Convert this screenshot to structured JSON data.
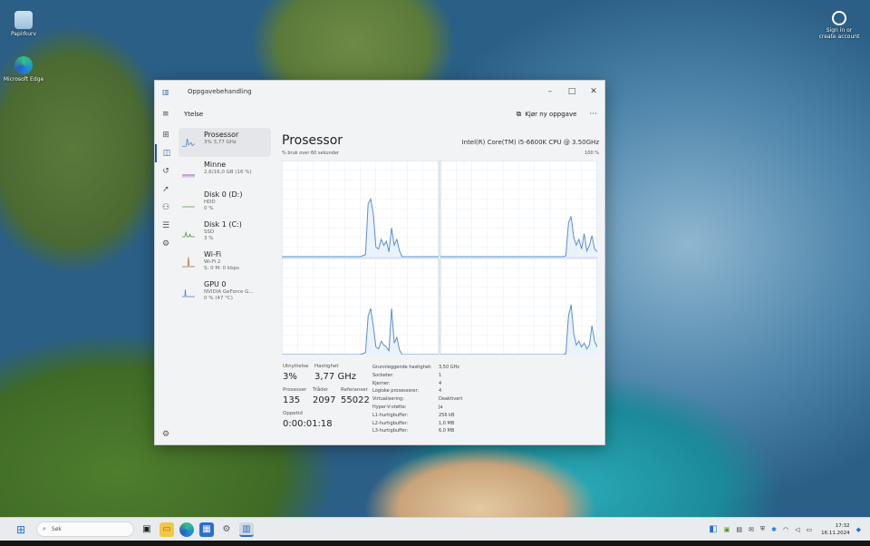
{
  "desktop": {
    "icons": [
      {
        "label": "Papirkurv",
        "icon": "recycle-bin-icon"
      },
      {
        "label": "Microsoft Edge",
        "icon": "edge-icon"
      },
      {
        "label": "Sign in or create account",
        "icon": "account-icon"
      }
    ]
  },
  "window": {
    "app_title": "Oppgavebehandling",
    "controls": {
      "minimize": "–",
      "maximize": "□",
      "close": "✕"
    },
    "page_title": "Ytelse",
    "run_task": "Kjør ny oppgave",
    "more": "···"
  },
  "resources": [
    {
      "name": "Prosessor",
      "detail": "3% 3,77 GHz",
      "color": "#3d7bc4"
    },
    {
      "name": "Minne",
      "detail": "2,6/16,0 GB (16 %)",
      "color": "#8e4ab0"
    },
    {
      "name": "Disk 0 (D:)",
      "detail": "HDD",
      "detail2": "0 %",
      "color": "#4f8f3a"
    },
    {
      "name": "Disk 1 (C:)",
      "detail": "SSD",
      "detail2": "3 %",
      "color": "#4f8f3a"
    },
    {
      "name": "Wi-Fi",
      "detail": "Wi-Fi 2",
      "detail2": "S: 0 M: 0 kbps",
      "color": "#b0622a"
    },
    {
      "name": "GPU 0",
      "detail": "NVIDIA GeForce G...",
      "detail2": "0 % (47 °C)",
      "color": "#3d7bc4"
    }
  ],
  "main": {
    "title": "Prosessor",
    "cpu_name": "Intel(R) Core(TM) i5-6600K CPU @ 3.50GHz",
    "graph_caption": "% bruk over 60 sekunder",
    "graph_max": "100 %",
    "line_color": "#5b8fd0",
    "stats": {
      "utilization_label": "Utnyttelse",
      "utilization": "3%",
      "speed_label": "Hastighet",
      "speed": "3,77 GHz",
      "processes_label": "Prosesser",
      "processes": "135",
      "threads_label": "Tråder",
      "threads": "2097",
      "handles_label": "Referanser",
      "handles": "55022",
      "uptime_label": "Oppetid",
      "uptime": "0:00:01:18"
    },
    "specs": [
      {
        "k": "Grunnleggende hastighet:",
        "v": "3,50 GHz"
      },
      {
        "k": "Socketer:",
        "v": "1"
      },
      {
        "k": "Kjerner:",
        "v": "4"
      },
      {
        "k": "Logiske prosessorer:",
        "v": "4"
      },
      {
        "k": "Virtualisering:",
        "v": "Deaktivert"
      },
      {
        "k": "Hyper-V-støtte:",
        "v": "Ja"
      },
      {
        "k": "L1-hurtigbuffer:",
        "v": "256 kB"
      },
      {
        "k": "L2-hurtigbuffer:",
        "v": "1,0 MB"
      },
      {
        "k": "L3-hurtigbuffer:",
        "v": "6,0 MB"
      }
    ],
    "core_usage": [
      [
        0,
        0,
        0,
        0,
        0,
        0,
        0,
        0,
        0,
        0,
        0,
        0,
        0,
        0,
        0,
        0,
        0,
        0,
        0,
        0,
        0,
        0,
        0,
        0,
        0,
        0,
        0,
        0,
        0,
        0,
        0,
        1,
        2,
        55,
        60,
        45,
        10,
        8,
        18,
        12,
        16,
        5,
        30,
        12,
        18,
        6,
        0,
        0,
        0,
        0,
        0,
        0,
        0,
        0,
        0,
        0,
        0,
        0,
        0,
        0,
        0
      ],
      [
        0,
        0,
        0,
        0,
        0,
        0,
        0,
        0,
        0,
        0,
        0,
        0,
        0,
        0,
        0,
        0,
        0,
        0,
        0,
        0,
        0,
        0,
        0,
        0,
        0,
        0,
        0,
        0,
        0,
        0,
        0,
        0,
        0,
        0,
        0,
        0,
        0,
        0,
        0,
        0,
        0,
        0,
        0,
        0,
        0,
        0,
        0,
        0,
        1,
        35,
        42,
        20,
        12,
        18,
        8,
        24,
        6,
        12,
        22,
        8,
        5
      ],
      [
        0,
        0,
        0,
        0,
        0,
        0,
        0,
        0,
        0,
        0,
        0,
        0,
        0,
        0,
        0,
        0,
        0,
        0,
        0,
        0,
        0,
        0,
        0,
        0,
        0,
        0,
        0,
        0,
        0,
        0,
        0,
        1,
        2,
        40,
        48,
        30,
        8,
        6,
        14,
        10,
        8,
        4,
        48,
        12,
        18,
        5,
        0,
        0,
        0,
        0,
        0,
        0,
        0,
        0,
        0,
        0,
        0,
        0,
        0,
        0,
        0
      ],
      [
        0,
        0,
        0,
        0,
        0,
        0,
        0,
        0,
        0,
        0,
        0,
        0,
        0,
        0,
        0,
        0,
        0,
        0,
        0,
        0,
        0,
        0,
        0,
        0,
        0,
        0,
        0,
        0,
        0,
        0,
        0,
        0,
        0,
        0,
        0,
        0,
        0,
        0,
        0,
        0,
        0,
        0,
        0,
        0,
        0,
        0,
        0,
        0,
        1,
        40,
        52,
        22,
        10,
        14,
        8,
        12,
        6,
        10,
        30,
        14,
        8
      ]
    ]
  },
  "taskbar": {
    "search_placeholder": "Søk",
    "time": "17:32",
    "date": "16.11.2024"
  }
}
